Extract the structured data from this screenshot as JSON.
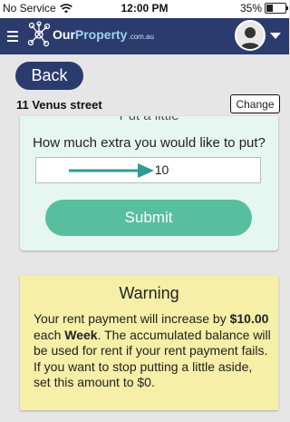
{
  "status_bar": {
    "carrier": "No Service",
    "time": "12:00 PM",
    "battery": "35%",
    "battery_level": 0.35
  },
  "nav": {
    "logo_prefix": "Our",
    "logo_highlight": "Property",
    "logo_domain": ".com.au"
  },
  "header": {
    "back_label": "Back",
    "address": "11 Venus street",
    "change_label": "Change"
  },
  "card": {
    "title_partial": "Put a little",
    "question": "How much extra you would like to put?",
    "amount_value": "10",
    "submit_label": "Submit",
    "accent_color": "#58bf9e"
  },
  "warning": {
    "title": "Warning",
    "text_1": "Your rent payment will increase by ",
    "amount": "$10.00",
    "text_2": " each ",
    "period": "Week",
    "text_3": ". The accumulated balance will be used for rent if your rent payment fails. If you want to stop putting a little aside, set this amount to $0."
  },
  "colors": {
    "nav_bg": "#2b3b6e",
    "card_bg": "#e6f7f1",
    "warning_bg": "#f5efa8",
    "page_bg": "#e6e6e6"
  }
}
